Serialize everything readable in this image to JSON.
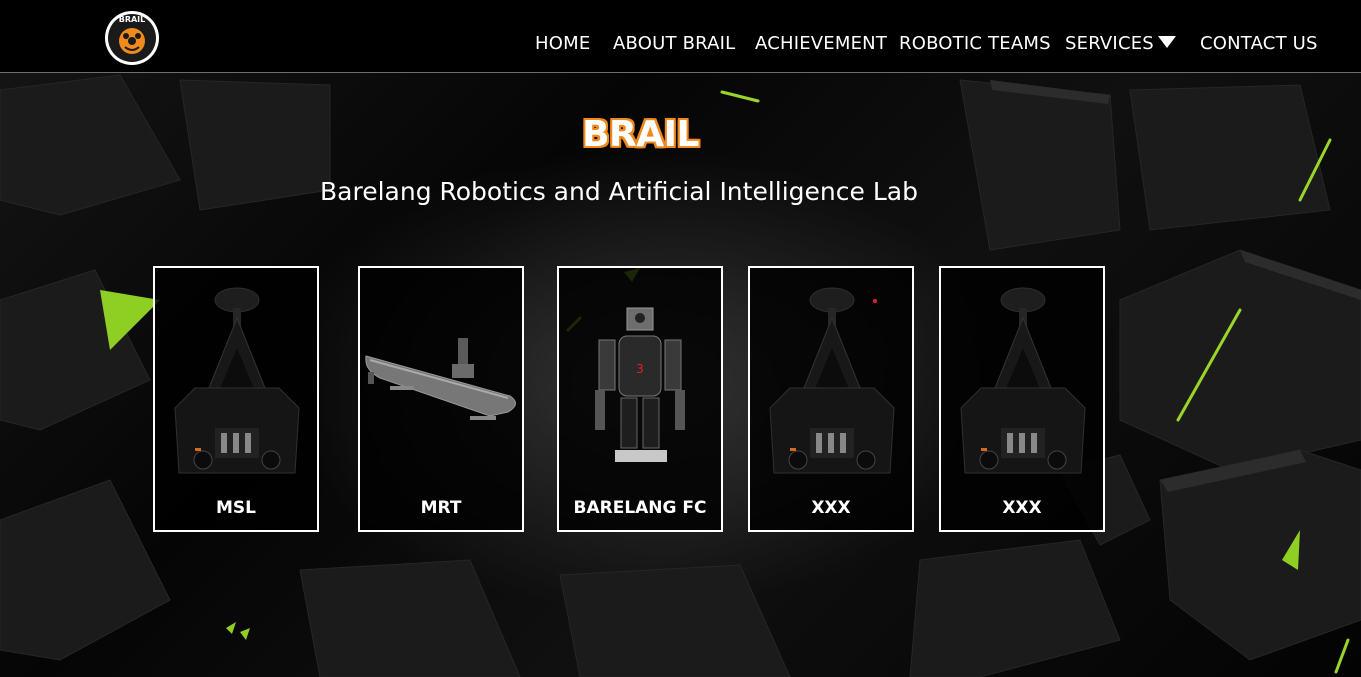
{
  "nav": {
    "logo_text": "BRAIL",
    "items": [
      {
        "label": "HOME"
      },
      {
        "label": "ABOUT BRAIL"
      },
      {
        "label": "ACHIEVEMENT"
      },
      {
        "label": "ROBOTIC TEAMS"
      },
      {
        "label": "SERVICES",
        "has_dropdown": true
      },
      {
        "label": "CONTACT US"
      }
    ]
  },
  "hero": {
    "title": "BRAIL",
    "subtitle": "Barelang Robotics and Artificial Intelligence Lab"
  },
  "teams": [
    {
      "label": "MSL",
      "image": "soccer-robot-icon"
    },
    {
      "label": "MRT",
      "image": "submarine-icon"
    },
    {
      "label": "BARELANG FC",
      "image": "humanoid-robot-icon"
    },
    {
      "label": "XXX",
      "image": "soccer-robot-icon"
    },
    {
      "label": "XXX",
      "image": "soccer-robot-icon"
    }
  ],
  "colors": {
    "background": "#000000",
    "accent_orange": "#f08a1c",
    "accent_green": "#a6e22e",
    "text": "#ffffff",
    "card_border": "#ffffff"
  }
}
